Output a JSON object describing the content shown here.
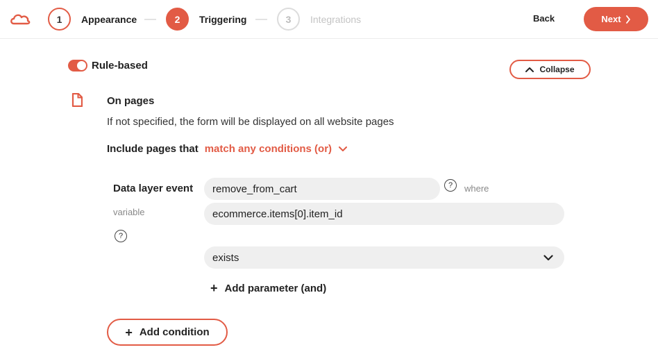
{
  "header": {
    "steps": [
      {
        "number": "1",
        "label": "Appearance"
      },
      {
        "number": "2",
        "label": "Triggering"
      },
      {
        "number": "3",
        "label": "Integrations"
      }
    ],
    "back_label": "Back",
    "next_label": "Next"
  },
  "rule": {
    "toggle_on": true,
    "label": "Rule-based",
    "collapse_label": "Collapse"
  },
  "pages": {
    "title": "On pages",
    "hint": "If not specified, the form will be displayed on all website pages",
    "include_label": "Include pages that",
    "match_label": "match any conditions (or)"
  },
  "condition": {
    "event_label": "Data layer event",
    "event_value": "remove_from_cart",
    "where_label": "where",
    "variable_label": "variable",
    "variable_value": "ecommerce.items[0].item_id",
    "operator_value": "exists",
    "add_parameter_label": "Add parameter (and)",
    "help_glyph": "?"
  },
  "add_condition_label": "Add condition",
  "colors": {
    "accent": "#e25b45"
  },
  "icons": [
    "logo-cloud-icon",
    "chevron-right-icon",
    "chevron-up-icon",
    "page-icon",
    "chevron-down-icon",
    "help-icon",
    "plus-icon"
  ]
}
